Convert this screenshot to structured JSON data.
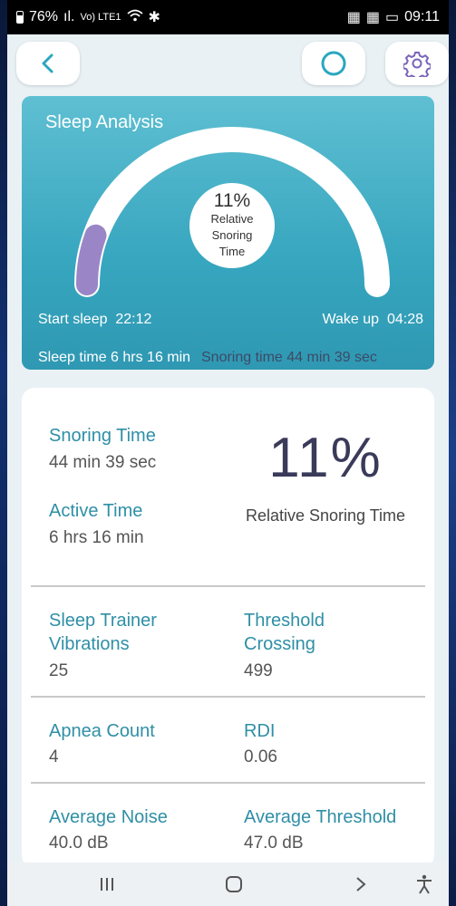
{
  "status_bar": {
    "battery": "76%",
    "network": "Vo) LTE1",
    "time": "09:11"
  },
  "toolbar": {
    "back_icon": "chevron-left-icon",
    "power_icon": "circle-icon",
    "settings_icon": "gear-icon"
  },
  "analysis": {
    "title": "Sleep Analysis",
    "center_percent": "11%",
    "center_label": "Relative Snoring Time",
    "start_label": "Start sleep",
    "start_time": "22:12",
    "wake_label": "Wake up",
    "wake_time": "04:28",
    "sleep_time_text": "Sleep time 6 hrs 16 min",
    "snoring_time_text": "Snoring time 44 min 39 sec",
    "snoring_fraction": 0.11,
    "gauge_color": "#9a86c6"
  },
  "stats": {
    "snoring_time_label": "Snoring Time",
    "snoring_time_value": "44 min 39 sec",
    "active_time_label": "Active Time",
    "active_time_value": "6 hrs 16 min",
    "relative_percent": "11%",
    "relative_label": "Relative Snoring Time",
    "trainer_label_1": "Sleep Trainer",
    "trainer_label_2": "Vibrations",
    "trainer_value": "25",
    "threshold_label_1": "Threshold",
    "threshold_label_2": "Crossing",
    "threshold_value": "499",
    "apnea_label": "Apnea Count",
    "apnea_value": "4",
    "rdi_label": "RDI",
    "rdi_value": "0.06",
    "avg_noise_label": "Average Noise",
    "avg_noise_value": "40.0 dB",
    "avg_threshold_label": "Average Threshold",
    "avg_threshold_value": "47.0 dB"
  },
  "nav": {
    "recents_icon": "recents-icon",
    "home_icon": "home-icon",
    "back_icon": "back-icon",
    "accessibility_icon": "accessibility-icon"
  },
  "colors": {
    "accent": "#2f8fa6",
    "card_gradient_top": "#5fbfd2",
    "card_gradient_bottom": "#2f98b3"
  }
}
